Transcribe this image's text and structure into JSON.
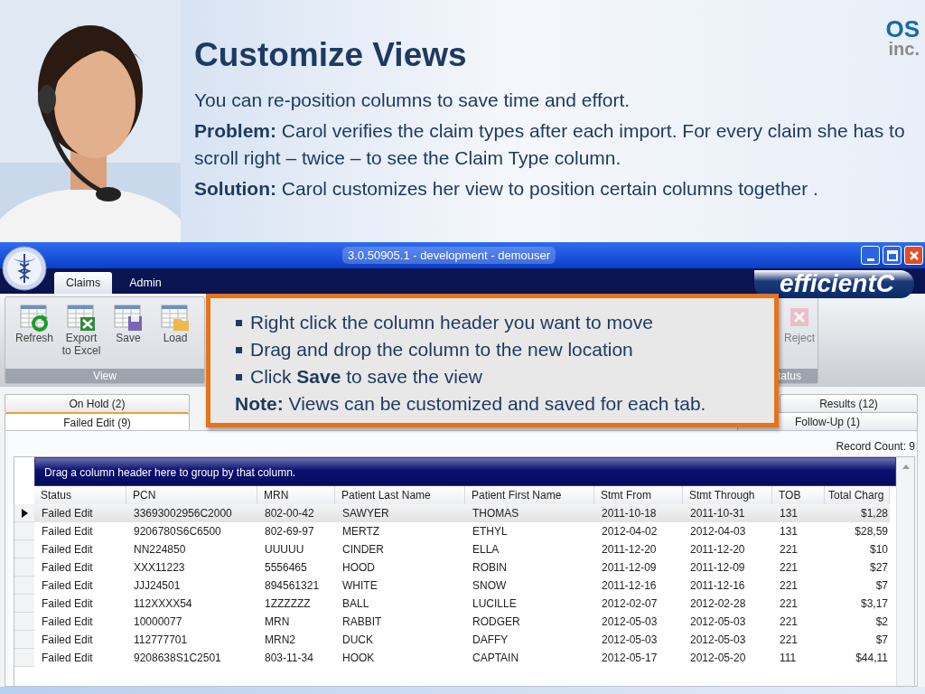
{
  "slide": {
    "title": "Customize Views",
    "intro": "You can re-position columns to save time and effort.",
    "problem": "**Problem:**  Carol verifies the claim types after each import.  For every claim she has to scroll right – twice – to see the Claim Type column.",
    "solution": "**Solution:** Carol customizes her view to position certain columns together .",
    "logo_top": "OS",
    "logo_bottom": "inc."
  },
  "window": {
    "title": "3.0.50905.1 - development - demouser",
    "brand": "efficientC",
    "ribbon_tabs": [
      {
        "label": "Claims",
        "selected": true
      },
      {
        "label": "Admin",
        "selected": false
      }
    ],
    "ribbon_groups": [
      {
        "label": "View",
        "buttons": [
          {
            "label": "Refresh",
            "kind": "refresh",
            "disabled": false
          },
          {
            "label": "Export to Excel",
            "kind": "excel",
            "disabled": false
          },
          {
            "label": "Save",
            "kind": "save",
            "disabled": false
          },
          {
            "label": "Load",
            "kind": "load",
            "disabled": false
          }
        ]
      },
      {
        "label": "tatus",
        "buttons": [
          {
            "label": "Reject",
            "kind": "reject",
            "disabled": true
          }
        ]
      }
    ],
    "tab_rows": [
      [
        {
          "label": "On Hold (2)",
          "selected": false
        },
        {
          "label": "Results (12)",
          "selected": false
        }
      ],
      [
        {
          "label": "Failed Edit (9)",
          "selected": true
        },
        {
          "label": "Follow-Up (1)",
          "selected": false
        }
      ]
    ],
    "record_count": "Record Count: 9",
    "grid": {
      "group_hint": "Drag a column header here to group by that column.",
      "columns": [
        "Status",
        "PCN",
        "MRN",
        "Patient Last Name",
        "Patient First Name",
        "Stmt From",
        "Stmt Through",
        "TOB",
        "Total Charg"
      ],
      "rows": [
        {
          "selected": true,
          "cells": [
            "Failed Edit",
            "33693002956C2000",
            "802-00-42",
            "SAWYER",
            "THOMAS",
            "2011-10-18",
            "2011-10-31",
            "131",
            "$1,28"
          ]
        },
        {
          "selected": false,
          "cells": [
            "Failed Edit",
            "9206780S6C6500",
            "802-69-97",
            "MERTZ",
            "ETHYL",
            "2012-04-02",
            "2012-04-03",
            "131",
            "$28,59"
          ]
        },
        {
          "selected": false,
          "cells": [
            "Failed Edit",
            "NN224850",
            "UUUUU",
            "CINDER",
            "ELLA",
            "2011-12-20",
            "2011-12-20",
            "221",
            "$10"
          ]
        },
        {
          "selected": false,
          "cells": [
            "Failed Edit",
            "XXX11223",
            "5556465",
            "HOOD",
            "ROBIN",
            "2011-12-09",
            "2011-12-09",
            "221",
            "$27"
          ]
        },
        {
          "selected": false,
          "cells": [
            "Failed Edit",
            "JJJ24501",
            "894561321",
            "WHITE",
            "SNOW",
            "2011-12-16",
            "2011-12-16",
            "221",
            "$7"
          ]
        },
        {
          "selected": false,
          "cells": [
            "Failed Edit",
            "112XXXX54",
            "1ZZZZZZ",
            "BALL",
            "LUCILLE",
            "2012-02-07",
            "2012-02-28",
            "221",
            "$3,17"
          ]
        },
        {
          "selected": false,
          "cells": [
            "Failed Edit",
            "10000077",
            "MRN",
            "RABBIT",
            "RODGER",
            "2012-05-03",
            "2012-05-03",
            "221",
            "$2"
          ]
        },
        {
          "selected": false,
          "cells": [
            "Failed Edit",
            "112777701",
            "MRN2",
            "DUCK",
            "DAFFY",
            "2012-05-03",
            "2012-05-03",
            "221",
            "$7"
          ]
        },
        {
          "selected": false,
          "cells": [
            "Failed Edit",
            "9208638S1C2501",
            "803-11-34",
            "HOOK",
            "CAPTAIN",
            "2012-05-17",
            "2012-05-20",
            "111",
            "$44,11"
          ]
        }
      ]
    }
  },
  "callout": {
    "bullets": [
      "Right click the column header you want to move",
      "Drag and drop the column to the new location",
      "Click **Save** to save the view"
    ],
    "note": "**Note:** Views can be customized and saved for each tab."
  }
}
